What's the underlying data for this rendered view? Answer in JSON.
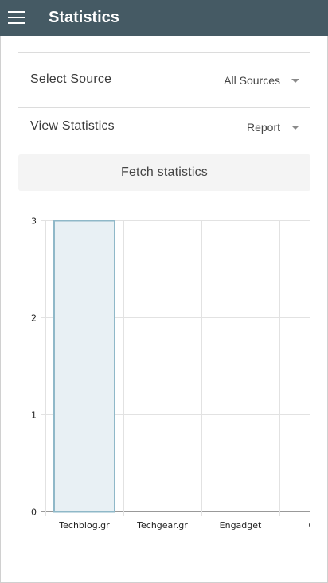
{
  "app": {
    "title": "Statistics"
  },
  "filters": {
    "source": {
      "label": "Select Source",
      "selected": "All Sources"
    },
    "view": {
      "label": "View Statistics",
      "selected": "Report"
    }
  },
  "actions": {
    "fetch_label": "Fetch statistics"
  },
  "chart_data": {
    "type": "bar",
    "categories": [
      "Techblog.gr",
      "Techgear.gr",
      "Engadget",
      "GSM"
    ],
    "values": [
      3,
      0,
      0,
      0
    ],
    "ylim": [
      0,
      3
    ],
    "yticks": [
      0,
      1,
      2,
      3
    ],
    "grid": true,
    "bar_fill": "#e8f0f4",
    "bar_stroke": "#8fb8c8"
  },
  "colors": {
    "appbar": "#455a64"
  }
}
